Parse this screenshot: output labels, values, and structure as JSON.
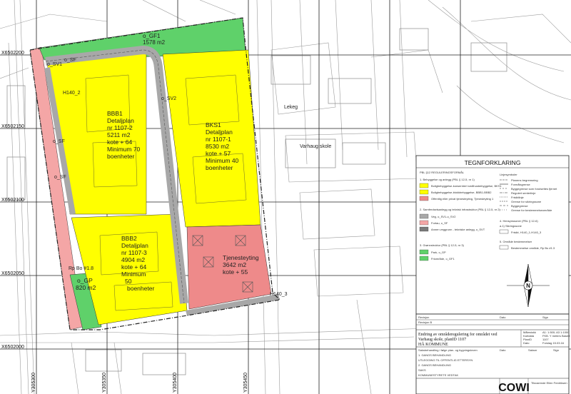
{
  "map": {
    "coords_y": [
      "X6502200",
      "X6502150",
      "X6502100",
      "X6502050",
      "X6502000"
    ],
    "coords_x": [
      "Y305300",
      "Y305350",
      "Y305400",
      "Y305450"
    ],
    "areas": {
      "gf1": {
        "line1": "o_GF1",
        "line2": "1578 m2"
      },
      "bks1": {
        "lines": [
          "BKS1",
          "Detaljplan",
          "nr 1107-1",
          "8530 m2",
          "kote + 57",
          "Minimum 40",
          "boenheter"
        ]
      },
      "bbb1": {
        "lines": [
          "BBB1",
          "Detaljplan",
          "nr 1107-2",
          "5211 m2",
          "kote + 64",
          "Minimum 70",
          "boenheter"
        ]
      },
      "bbb2": {
        "lines": [
          "BBB2",
          "Detaljplan",
          "nr 1107-3",
          "4904 m2",
          "kote + 64",
          "Minimum",
          "50",
          "boenheter"
        ]
      },
      "tj": {
        "lines": [
          "Tjenesteyting",
          "3642 m2",
          "kote + 55"
        ]
      },
      "gp": {
        "line1": "o_GP",
        "line2": "820 m2"
      }
    },
    "labels": {
      "sv1": "o_SV1",
      "sv2": "o_SV2",
      "sf_top": "o_SF",
      "sf_left": "o_SF",
      "sf_mid": "o_SF",
      "h140": "H140_2",
      "h140_3": "H140_3",
      "road": "Rp Bo #1.8",
      "school": "Varhaug skole",
      "street": "Lekeg"
    }
  },
  "legend": {
    "title": "TEGNFORKLARING",
    "subtitle": "PBL §12 REGULERINGSFORMÅL",
    "items": [
      "1. Bebyggelse og anlegg (PBL § 12-5, nr 1)",
      "Boligbebyggelse-konsentrert småhusbebyggelse, BKS1",
      "Boligbebyggelse-blokkbebyggelse, BBB1-BBB2",
      "Offentlig eller privat tjenesteyting, Tjenesteyting 1",
      "2. Samferdselsanlegg og teknisk infrastruktur (PBL § 12-5, nr 2)",
      "Veg, o_SV1-o_SV2",
      "Fortau, o_SF",
      "Annen veggrunn - tekniske anlegg, o_SVT",
      "3. Grønnstruktur (PBL § 12-5, nr 3)",
      "Park, o_GP",
      "Friområde, o_GF1",
      "4. Hensynssoner (PBL § 12-6)",
      "a.1) Sikringssone",
      "Frisikt, H140_1-H140_3",
      "5. Område bestemmelser",
      "Bestemmelse område, Rp Bo #1.3"
    ],
    "linjer_title": "Linjesymboler",
    "linjer": [
      "Planens begrensning",
      "Formålsgrense",
      "Byggegrense som forutsettes fjernet",
      "Regulert senterlinje",
      "Frisiktlinje",
      "Grense for sikringssone",
      "Byggegrense",
      "Grense for bestemmelseområde"
    ]
  },
  "title_block": {
    "revisjon": "Revisjon",
    "dato_hdr": "Dato",
    "sign_hdr": "Sign",
    "rev_row": "Revisjon B",
    "main1": "Endring av områderegulering for området ved",
    "main2": "Varhaug skole, planID 1107",
    "main3": "HÅ KOMMUNE",
    "malestokk": "Målestokk",
    "malestokk_val": "A1: 1:500; A3 1:1000",
    "kartdata": "Kartdata",
    "kartdata_val": "FKB. Y meters Basert",
    "planid": "PlanID",
    "planid_val": "1107",
    "dato": "Dato",
    "dato_val": "Forslag 15.03.16",
    "steps": [
      "Saksbehandling i følge plan- og bygningsloven",
      "1. GANGS BEHANDLING",
      "UTLEGGING TIL OFFENTLIG ETTERSYN",
      "2. GANGS BEHANDLING",
      "SAKS",
      "KOMMUNESTYRETS VEDTAK"
    ],
    "cols": [
      "Dato",
      "Saksnr",
      "Sign"
    ],
    "company": "COWI",
    "sign_label": "Tilsvarende Ellen Fredriksen"
  }
}
